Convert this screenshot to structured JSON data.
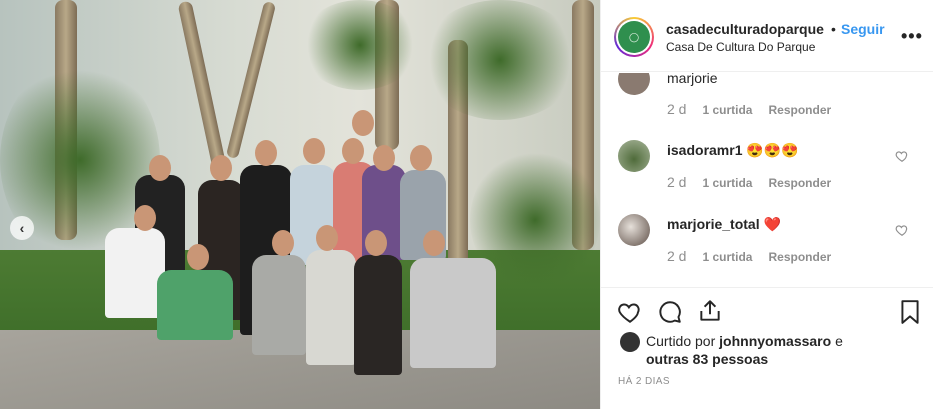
{
  "post": {
    "username": "casadeculturadoparque",
    "separator": "•",
    "follow_label": "Seguir",
    "location": "Casa De Cultura Do Parque",
    "more_icon": "more-icon"
  },
  "comments": [
    {
      "user": "marjorie",
      "text": "",
      "time": "2 d",
      "likes": "1 curtida",
      "reply": "Responder"
    },
    {
      "user": "isadoramr1",
      "text": "😍😍😍",
      "time": "2 d",
      "likes": "1 curtida",
      "reply": "Responder"
    },
    {
      "user": "marjorie_total",
      "text": "❤️",
      "time": "2 d",
      "likes": "1 curtida",
      "reply": "Responder"
    }
  ],
  "likes_line": {
    "prefix": "Curtido por ",
    "user": "johnnyomassaro",
    "middle": " e",
    "others": "outras 83 pessoas"
  },
  "post_date": "HÁ 2 DIAS",
  "colors": {
    "link": "#3897f0",
    "text": "#262626",
    "muted": "#8e8e8e"
  }
}
